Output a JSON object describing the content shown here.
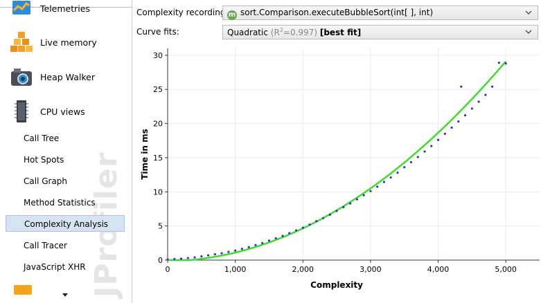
{
  "sidebar": {
    "items": [
      {
        "label": "Telemetries",
        "icon": "telemetries-icon"
      },
      {
        "label": "Live memory",
        "icon": "live-memory-icon"
      },
      {
        "label": "Heap Walker",
        "icon": "camera-icon"
      },
      {
        "label": "CPU views",
        "icon": "cpu-chip-icon"
      }
    ],
    "sub_items": [
      {
        "label": "Call Tree"
      },
      {
        "label": "Hot Spots"
      },
      {
        "label": "Call Graph"
      },
      {
        "label": "Method Statistics"
      },
      {
        "label": "Complexity Analysis",
        "selected": true
      },
      {
        "label": "Call Tracer"
      },
      {
        "label": "JavaScript XHR"
      }
    ],
    "watermark": "JProfiler"
  },
  "toolbar": {
    "recording_label": "Complexity recording:",
    "recording_badge": "m",
    "recording_value": "sort.Comparison.executeBubbleSort(int[ ], int)",
    "fits_label": "Curve fits:",
    "fits_type": "Quadratic",
    "fits_r_prefix": "(R",
    "fits_r_sup": "2",
    "fits_r_value": "=0.997)",
    "fits_best": "[best fit]"
  },
  "colors": {
    "points": "#2b35c8",
    "fit": "#3ddc2a",
    "selected_bg": "#d5e3f2",
    "badge": "#6aa84f"
  },
  "chart_data": {
    "type": "scatter",
    "xlabel": "Complexity",
    "ylabel": "Time in ms",
    "xlim": [
      0,
      5500
    ],
    "ylim": [
      0,
      31
    ],
    "xticks": [
      0,
      1000,
      2000,
      3000,
      4000,
      5000
    ],
    "xtick_labels": [
      "0",
      "1,000",
      "2,000",
      "3,000",
      "4,000",
      "5,000"
    ],
    "yticks": [
      0,
      5,
      10,
      15,
      20,
      25,
      30
    ],
    "ytick_labels": [
      "0",
      "5",
      "10",
      "15",
      "20",
      "25",
      "30"
    ],
    "grid": true,
    "series": [
      {
        "kind": "points",
        "x": [
          0,
          100,
          200,
          300,
          400,
          500,
          600,
          700,
          800,
          900,
          1000,
          1100,
          1200,
          1300,
          1400,
          1500,
          1600,
          1700,
          1800,
          1900,
          2000,
          2100,
          2200,
          2300,
          2400,
          2500,
          2600,
          2700,
          2800,
          2900,
          3000,
          3100,
          3200,
          3300,
          3400,
          3500,
          3600,
          3700,
          3800,
          3900,
          4000,
          4100,
          4200,
          4300,
          4340,
          4400,
          4500,
          4600,
          4700,
          4800,
          4900,
          5000
        ],
        "y": [
          0.1,
          0.15,
          0.2,
          0.3,
          0.4,
          0.55,
          0.7,
          0.85,
          1.0,
          1.2,
          1.4,
          1.65,
          1.9,
          2.2,
          2.5,
          2.85,
          3.2,
          3.55,
          3.95,
          4.35,
          4.75,
          5.2,
          5.7,
          6.15,
          6.65,
          7.2,
          7.75,
          8.3,
          8.9,
          9.5,
          10.1,
          10.75,
          11.45,
          12.1,
          12.8,
          13.6,
          14.35,
          15.1,
          15.9,
          16.7,
          17.6,
          18.5,
          19.4,
          20.3,
          25.4,
          21.2,
          22.2,
          23.2,
          24.2,
          25.4,
          28.9,
          28.8
        ]
      },
      {
        "kind": "fit",
        "equation": "quadratic",
        "coeffs": [
          1.15e-06,
          0.0001,
          -0.15
        ]
      }
    ]
  }
}
